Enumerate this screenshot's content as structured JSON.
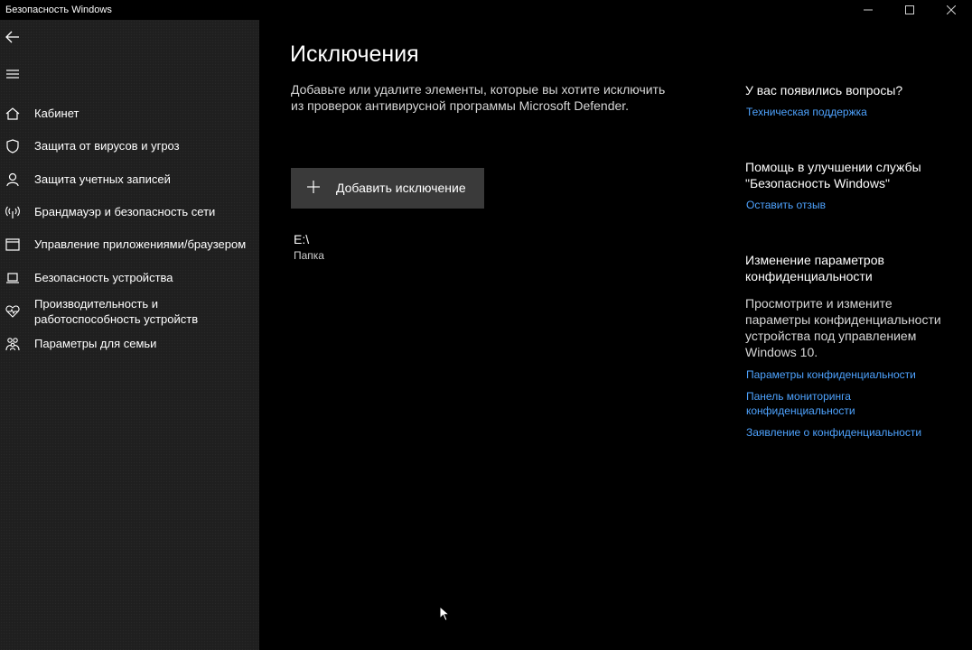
{
  "window": {
    "title": "Безопасность Windows",
    "minimize": "—",
    "maximize": "☐",
    "close": "✕"
  },
  "sidebar": {
    "items": [
      {
        "label": "Кабинет",
        "icon": "home-icon"
      },
      {
        "label": "Защита от вирусов и угроз",
        "icon": "shield-icon"
      },
      {
        "label": "Защита учетных записей",
        "icon": "person-icon"
      },
      {
        "label": "Брандмауэр и безопасность сети",
        "icon": "wifi-antenna-icon"
      },
      {
        "label": "Управление приложениями/браузером",
        "icon": "browser-window-icon"
      },
      {
        "label": "Безопасность устройства",
        "icon": "laptop-icon"
      },
      {
        "label": "Производительность и работоспособность устройств",
        "icon": "heart-pulse-icon"
      },
      {
        "label": "Параметры для семьи",
        "icon": "family-icon"
      }
    ]
  },
  "main": {
    "title": "Исключения",
    "description": "Добавьте или удалите элементы, которые вы хотите исключить из проверок антивирусной программы Microsoft Defender.",
    "add_button": "Добавить исключение",
    "exclusions": [
      {
        "path": "E:\\",
        "type": "Папка"
      }
    ]
  },
  "right": {
    "questions_heading": "У вас появились вопросы?",
    "support_link": "Техническая поддержка",
    "improve_heading": "Помощь в улучшении службы \"Безопасность Windows\"",
    "feedback_link": "Оставить отзыв",
    "privacy_heading": "Изменение параметров конфиденциальности",
    "privacy_text": "Просмотрите и измените параметры конфиденциальности устройства под управлением Windows 10.",
    "privacy_settings_link": "Параметры конфиденциальности",
    "privacy_dashboard_link": "Панель мониторинга конфиденциальности",
    "privacy_statement_link": "Заявление о конфиденциальности"
  },
  "colors": {
    "accent_link": "#4ea3ff",
    "sidebar_bg": "#1f1f1f",
    "button_bg": "#3a3a3a"
  }
}
